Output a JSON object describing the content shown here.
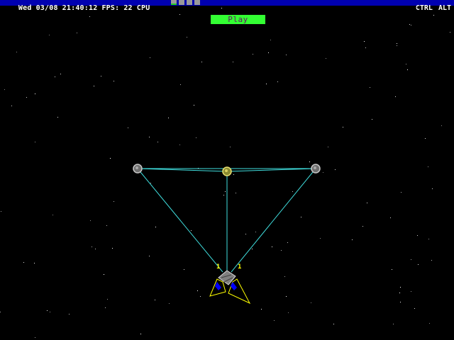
{
  "status_bar": {
    "day": "Wed",
    "date": "03/08",
    "time": "21:40:12",
    "fps_label": "FPS:",
    "fps_value": "22",
    "cpu_label": "CPU",
    "cpu_levels": [
      0.35,
      0.0,
      0.0,
      0.0
    ],
    "modifier_keys": [
      "CTRL",
      "ALT"
    ],
    "colors": {
      "background": "#0000b0",
      "text": "#ffffff",
      "cpu_fill": "#1ed01e",
      "cpu_empty": "#9a9a9a"
    }
  },
  "play_button": {
    "label": "Play",
    "background": "#33ff33",
    "text_color": "#6a0c6a"
  },
  "scene": {
    "background": "#000000",
    "tether_color": "#40e0e0",
    "ship_outline_color": "#ffff00",
    "ship_thruster_color": "#0000ff",
    "node_icons": [
      "gray-sphere-icon",
      "yellow-sphere-icon",
      "gray-sphere-icon"
    ],
    "ship_labels": [
      "1",
      "1"
    ]
  }
}
